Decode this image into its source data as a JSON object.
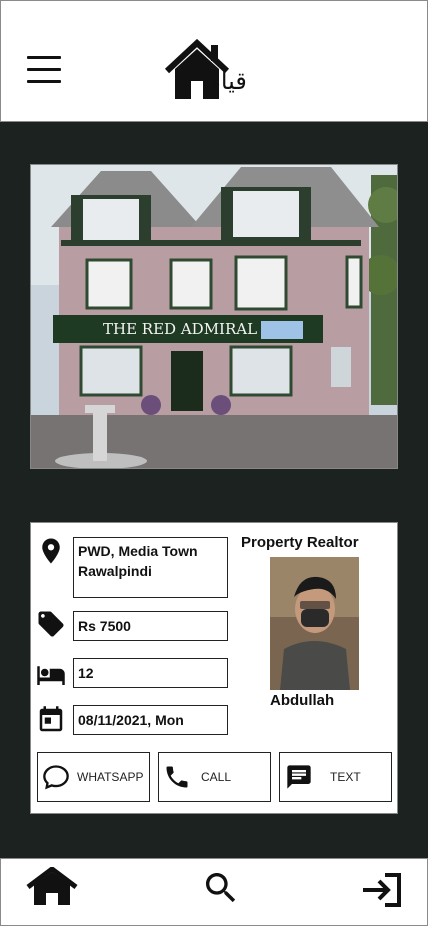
{
  "header": {
    "logo_text": "قيام",
    "menu_icon": "hamburger-menu-icon",
    "logo_icon": "house-logo-icon"
  },
  "listing": {
    "photo_sign_text": "THE RED ADMIRAL",
    "address": "PWD, Media Town\nRawalpindi",
    "price": "Rs 7500",
    "rooms": "12",
    "date": "08/11/2021, Mon"
  },
  "realtor": {
    "title": "Property Realtor",
    "name": "Abdullah"
  },
  "actions": {
    "whatsapp": "WHATSAPP",
    "call": "CALL",
    "text": "TEXT"
  },
  "nav": {
    "items": [
      "home-icon",
      "search-icon",
      "logout-icon"
    ]
  },
  "colors": {
    "background": "#1c2220",
    "card": "#ffffff",
    "accent": "#111111"
  }
}
